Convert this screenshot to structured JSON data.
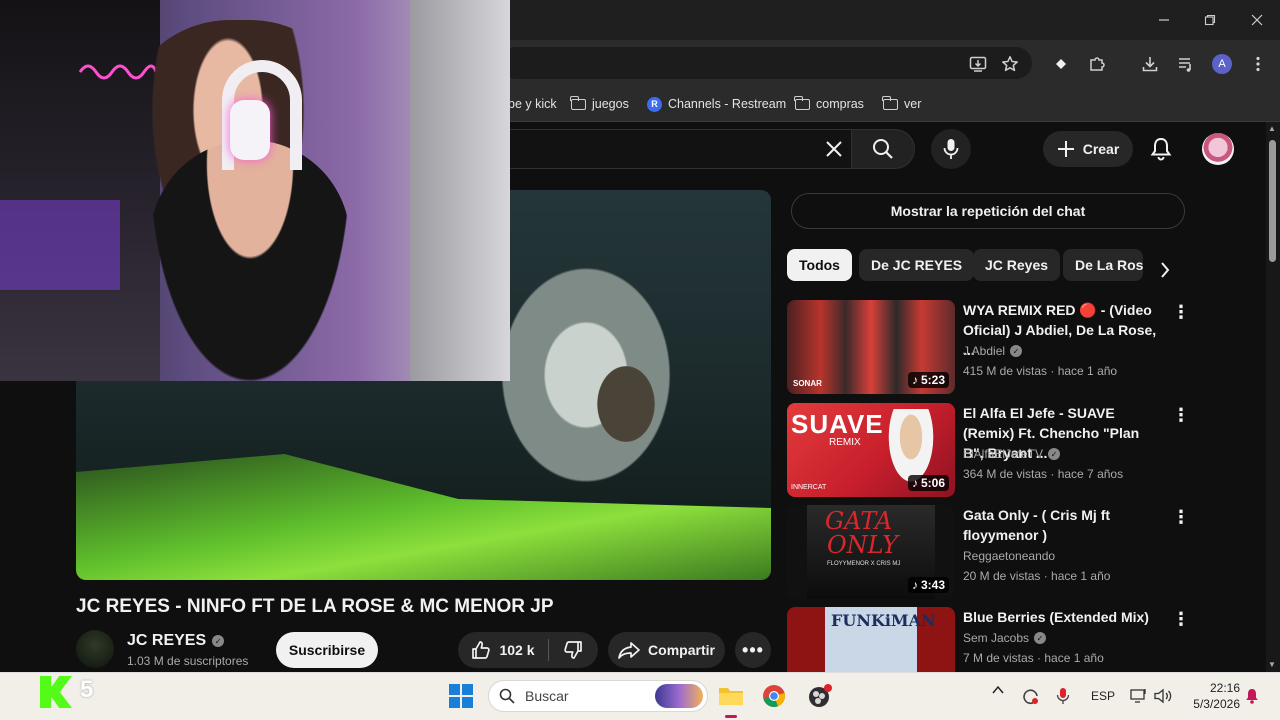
{
  "bookmarks": [
    {
      "label": "be y kick",
      "icon": "none"
    },
    {
      "label": "juegos",
      "icon": "folder-icon"
    },
    {
      "label": "Channels - Restream",
      "icon": "restream-icon",
      "badge": "R"
    },
    {
      "label": "compras",
      "icon": "folder-icon"
    },
    {
      "label": "ver",
      "icon": "folder-icon"
    }
  ],
  "browser": {
    "profile_initial": "A"
  },
  "header": {
    "create_label": "Crear"
  },
  "video": {
    "title": "JC REYES - NINFO FT DE LA ROSE & MC MENOR JP",
    "channel": "JC REYES",
    "subscribers": "1.03 M de suscriptores",
    "subscribe_label": "Suscribirse",
    "likes": "102 k",
    "share_label": "Compartir",
    "more_label": "•••"
  },
  "sidebar": {
    "chat_replay_label": "Mostrar la repetición del chat",
    "chips": [
      "Todos",
      "De JC REYES",
      "JC Reyes",
      "De La Rose"
    ],
    "active_chip": "Todos",
    "recommendations": [
      {
        "title": "WYA REMIX RED 🔴 - (Video Oficial) J Abdiel, De La Rose, ...",
        "channel": "J Abdiel",
        "meta": "415 M de vistas · hace 1 año",
        "duration": "5:23",
        "thumb_label": "SONAR"
      },
      {
        "title": "El Alfa El Jefe - SUAVE (Remix) Ft. Chencho \"Plan B\", Bryant ...",
        "channel": "ElAlfaElJefeTV",
        "meta": "364 M de vistas · hace 7 años",
        "duration": "5:06",
        "thumb_label": "SUAVE",
        "thumb_sub": "REMIX",
        "thumb_corner": "INNERCAT"
      },
      {
        "title": "Gata Only - ( Cris Mj ft floyymenor )",
        "channel": "Reggaetoneando",
        "meta": "20 M de vistas · hace 1 año",
        "duration": "3:43",
        "thumb_label": "GATA",
        "thumb_label2": "ONLY",
        "thumb_sub": "FLOYYMENOR X CRIS MJ"
      },
      {
        "title": "Blue Berries (Extended Mix)",
        "channel": "Sem Jacobs",
        "meta": "7 M de vistas · hace 1 año",
        "duration": "",
        "thumb_label": "FUNKiMAN"
      }
    ]
  },
  "stream_overlay": {
    "kick_count": "5"
  },
  "taskbar": {
    "search_placeholder": "Buscar",
    "language": "ESP",
    "time": "22:16",
    "date": "5/3/2026"
  },
  "colors": {
    "youtube_bg": "#0f0f0f",
    "chip_bg": "#272727",
    "kick_green": "#53fc18",
    "neon_pink": "#ff4fd0"
  }
}
